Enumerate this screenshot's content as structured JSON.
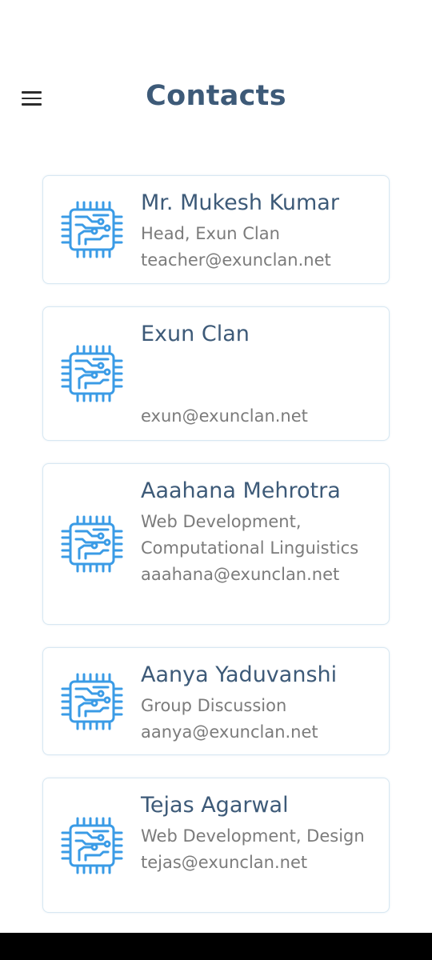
{
  "header": {
    "title": "Contacts",
    "menu_icon": "hamburger-menu-icon"
  },
  "colors": {
    "title": "#3d5a78",
    "name": "#3d5a78",
    "secondary_text": "#7b7b7b",
    "card_border": "#d8e8f2",
    "icon": "#3a9be6"
  },
  "contacts": [
    {
      "name": "Mr. Mukesh Kumar",
      "role": "Head, Exun Clan",
      "email": "teacher@exunclan.net",
      "icon": "circuit-chip-icon"
    },
    {
      "name": "Exun Clan",
      "role": "",
      "email": "exun@exunclan.net",
      "icon": "circuit-chip-icon"
    },
    {
      "name": "Aaahana Mehrotra",
      "role": "Web Development, Computational Linguistics",
      "email": "aaahana@exunclan.net",
      "icon": "circuit-chip-icon"
    },
    {
      "name": "Aanya Yaduvanshi",
      "role": "Group Discussion",
      "email": "aanya@exunclan.net",
      "icon": "circuit-chip-icon"
    },
    {
      "name": "Tejas Agarwal",
      "role": "Web Development, Design",
      "email": "tejas@exunclan.net",
      "icon": "circuit-chip-icon"
    }
  ]
}
